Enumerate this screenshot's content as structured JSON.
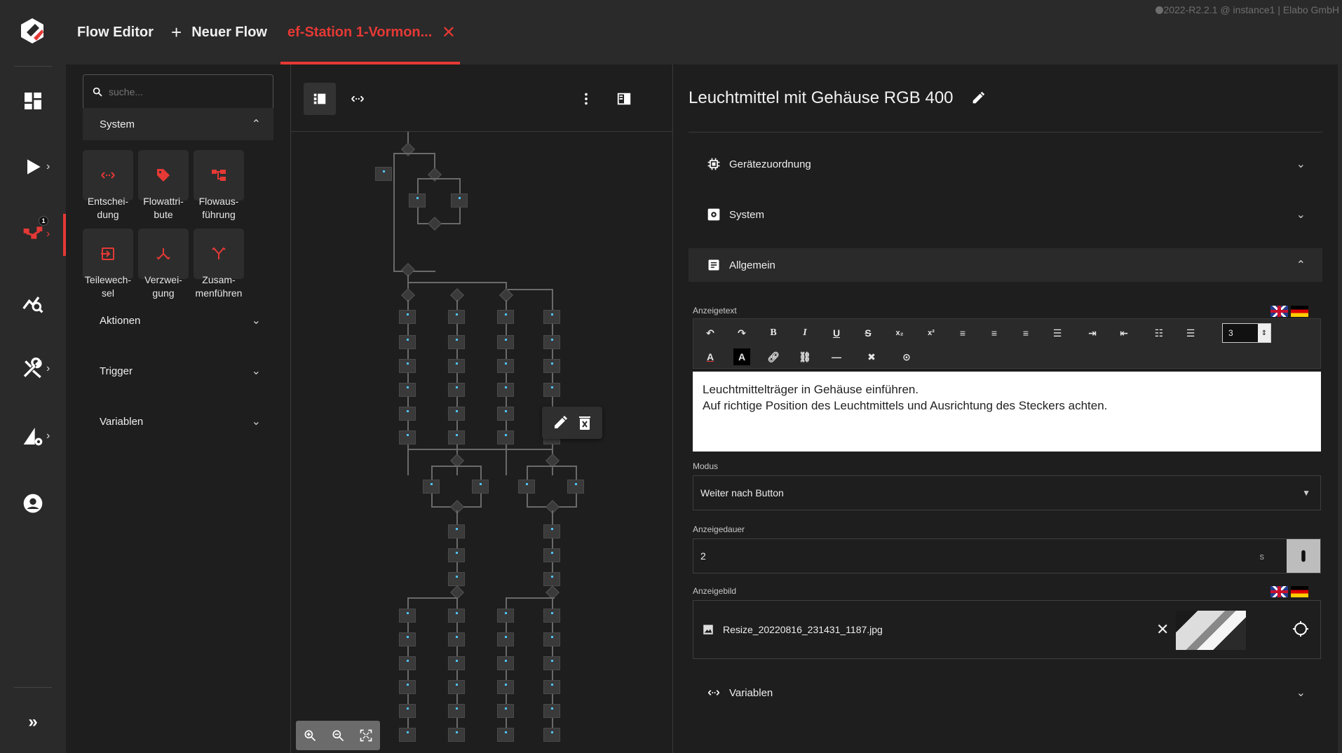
{
  "app": {
    "version": "2022-R2.2.1 @ instance1 | Elabo GmbH",
    "rail_badge": "1"
  },
  "tabs": {
    "flow_editor": "Flow Editor",
    "new_flow": "Neuer Flow",
    "active": "ef-Station 1-Vormon..."
  },
  "palette": {
    "search_placeholder": "suche...",
    "sections": {
      "system": "System",
      "actions": "Aktionen",
      "trigger": "Trigger",
      "variables": "Variablen"
    },
    "tiles": [
      {
        "label_1": "Entschei-",
        "label_2": "dung",
        "icon": "decision-icon"
      },
      {
        "label_1": "Flowattri-",
        "label_2": "bute",
        "icon": "tag-icon"
      },
      {
        "label_1": "Flowaus-",
        "label_2": "führung",
        "icon": "flow-execution-icon"
      },
      {
        "label_1": "Teilewech-",
        "label_2": "sel",
        "icon": "part-change-icon"
      },
      {
        "label_1": "Verzwei-",
        "label_2": "gung",
        "icon": "branch-icon"
      },
      {
        "label_1": "Zusam-",
        "label_2": "menführen",
        "icon": "merge-icon"
      }
    ]
  },
  "props": {
    "title": "Leuchtmittel mit Gehäuse RGB 400",
    "sections": {
      "device": "Gerätezuordnung",
      "system": "System",
      "general": "Allgemein",
      "variables": "Variablen"
    },
    "display_text_label": "Anzeigetext",
    "font_size": "3",
    "display_text_line1": "Leuchtmittelträger in Gehäuse einführen.",
    "display_text_line2": "Auf richtige Position des Leuchtmittels und Ausrichtung des Steckers achten.",
    "mode_label": "Modus",
    "mode_value": "Weiter nach Button",
    "duration_label": "Anzeigedauer",
    "duration_value": "2",
    "duration_unit": "s",
    "image_label": "Anzeigebild",
    "image_filename": "Resize_20220816_231431_1187.jpg"
  },
  "colors": {
    "accent": "#e53935",
    "rail_bg": "#2a2a2a",
    "content_bg": "#1e1e1e"
  }
}
